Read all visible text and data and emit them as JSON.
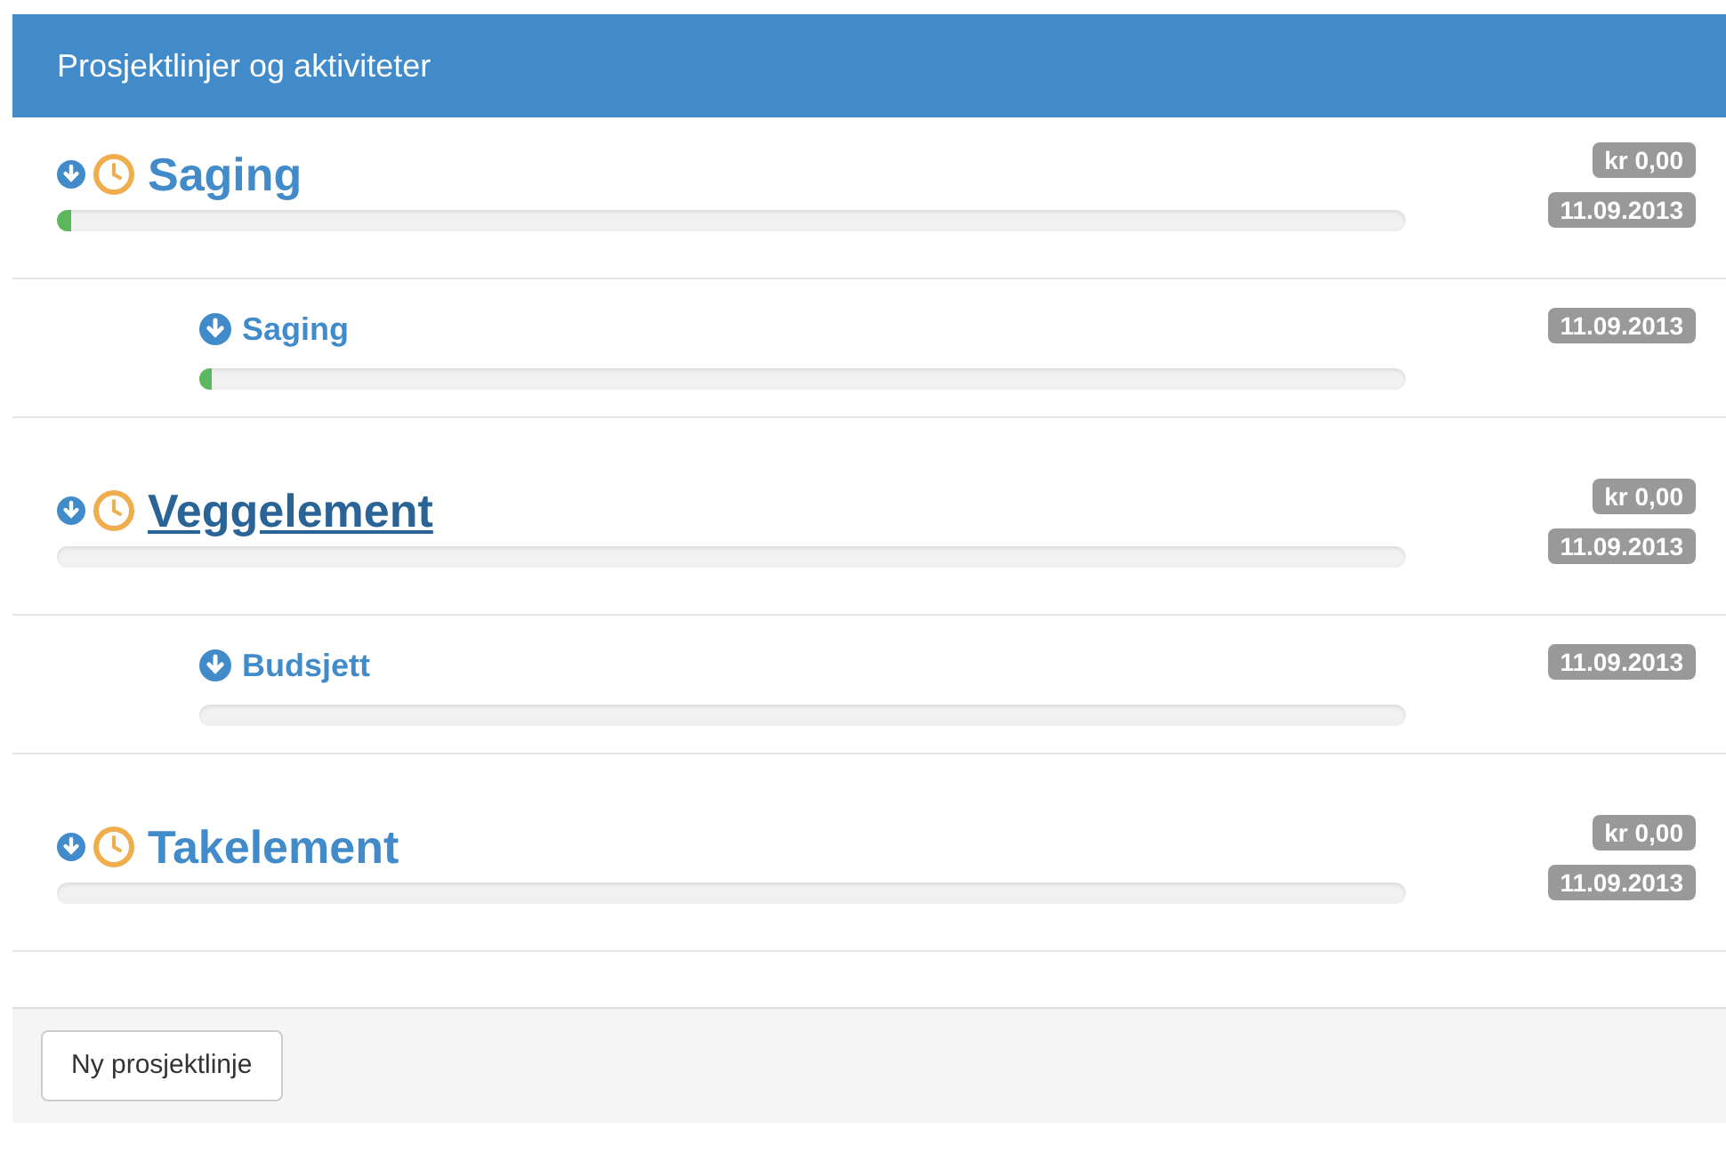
{
  "panel": {
    "title": "Prosjektlinjer og aktiviteter"
  },
  "projects": [
    {
      "name": "Saging",
      "hovered": false,
      "level": 0.01,
      "amount": "kr 0,00",
      "date": "11.09.2013",
      "children": [
        {
          "name": "Saging",
          "level": 0.01,
          "date": "11.09.2013"
        }
      ]
    },
    {
      "name": "Veggelement",
      "hovered": true,
      "level": 0,
      "amount": "kr 0,00",
      "date": "11.09.2013",
      "children": [
        {
          "name": "Budsjett",
          "level": 0,
          "date": "11.09.2013"
        }
      ]
    },
    {
      "name": "Takelement",
      "hovered": false,
      "level": 0,
      "amount": "kr 0,00",
      "date": "11.09.2013"
    }
  ],
  "footer": {
    "button": "Ny prosjektlinje"
  }
}
